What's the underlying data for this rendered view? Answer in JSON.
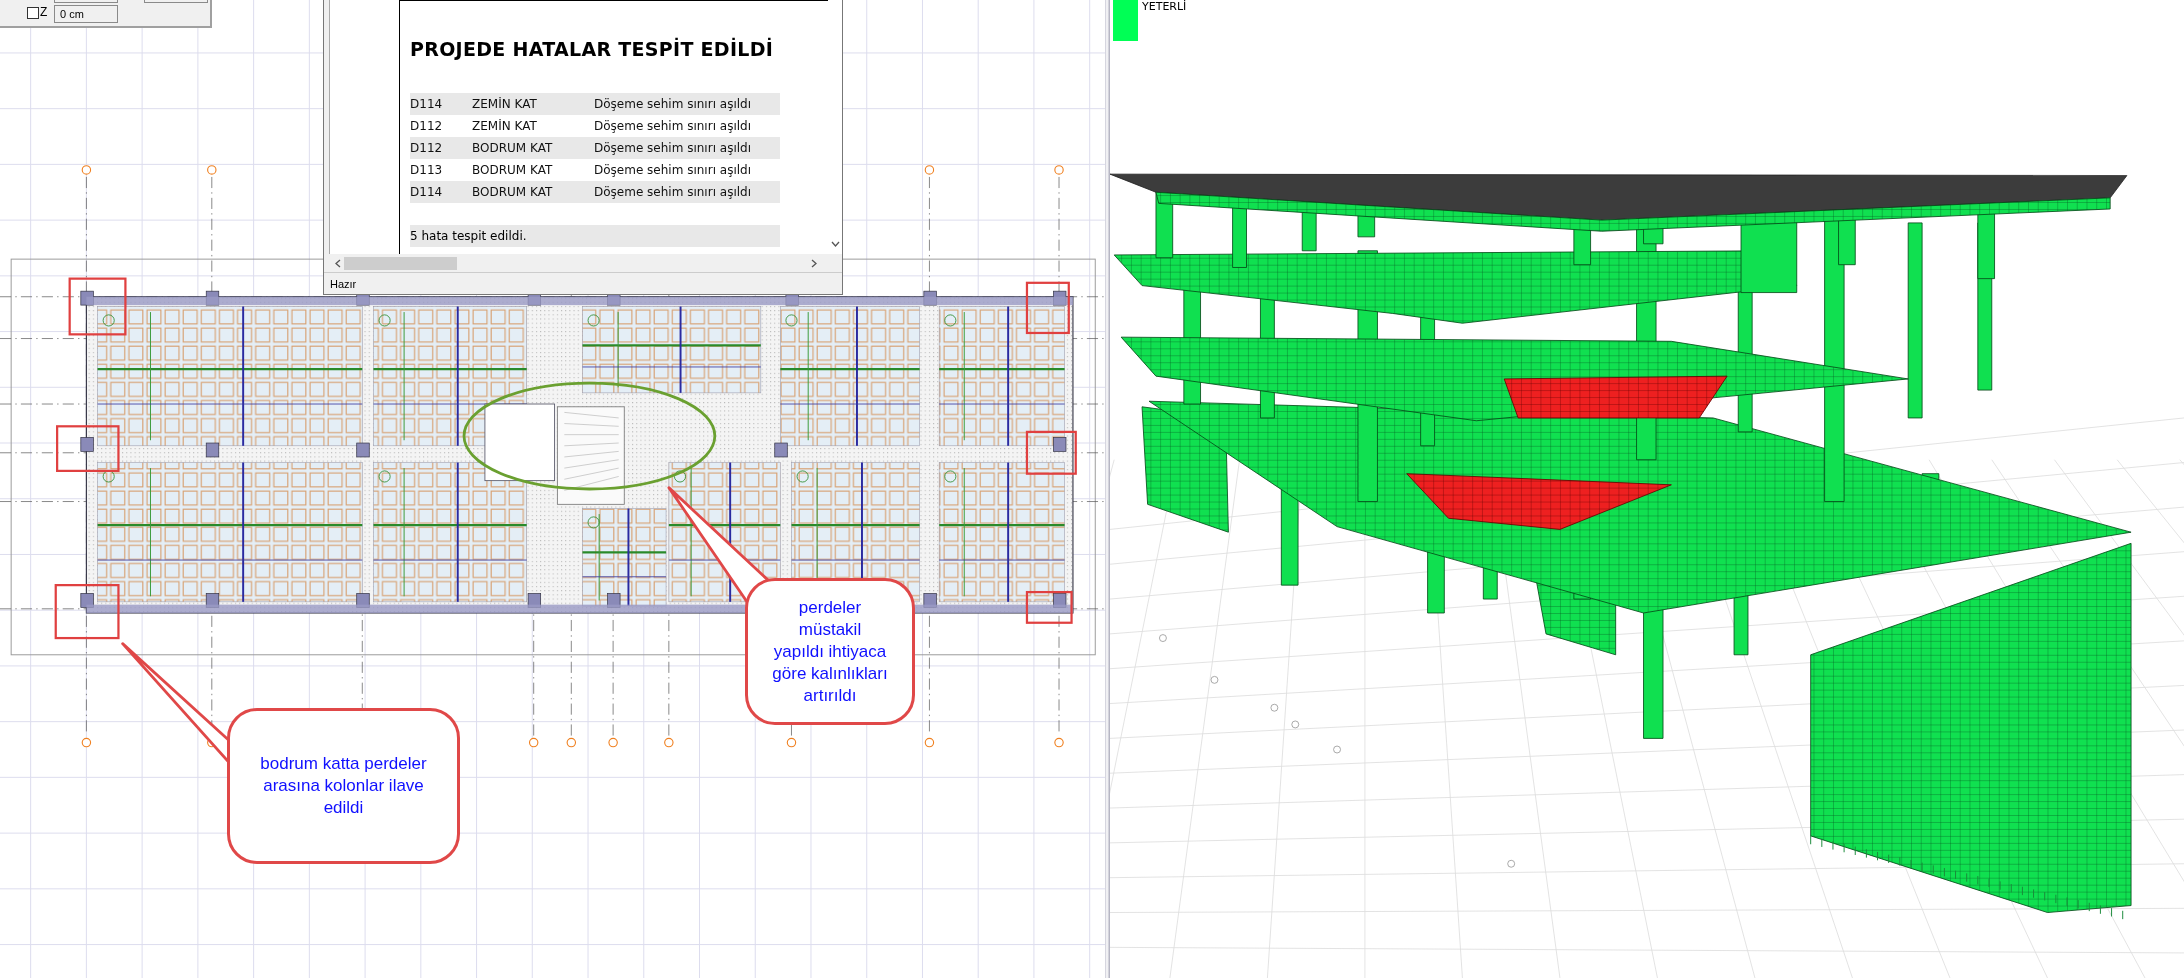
{
  "top_panel": {
    "z_checked": false,
    "z_label": "Z",
    "z_value": "0 cm"
  },
  "report": {
    "title": "PROJEDE HATALAR TESPİT EDİLDİ",
    "errors": [
      {
        "element": "D114",
        "floor": "ZEMİN KAT",
        "message": "Döşeme sehim sınırı aşıldı"
      },
      {
        "element": "D112",
        "floor": "ZEMİN KAT",
        "message": "Döşeme sehim sınırı aşıldı"
      },
      {
        "element": "D112",
        "floor": "BODRUM  KAT",
        "message": "Döşeme sehim sınırı aşıldı"
      },
      {
        "element": "D113",
        "floor": "BODRUM  KAT",
        "message": "Döşeme sehim sınırı aşıldı"
      },
      {
        "element": "D114",
        "floor": "BODRUM  KAT",
        "message": "Döşeme sehim sınırı aşıldı"
      }
    ],
    "summary": "5 hata tespit edildi.",
    "status": "Hazır"
  },
  "callouts": [
    {
      "text": "bodrum katta perdeler arasına kolonlar ilave edildi"
    },
    {
      "text": "perdeler müstakil yapıldı ihtiyaca göre kalınlıkları artırıldı"
    }
  ],
  "legend": {
    "label": "YETERLİ",
    "color": "#00ff55"
  }
}
